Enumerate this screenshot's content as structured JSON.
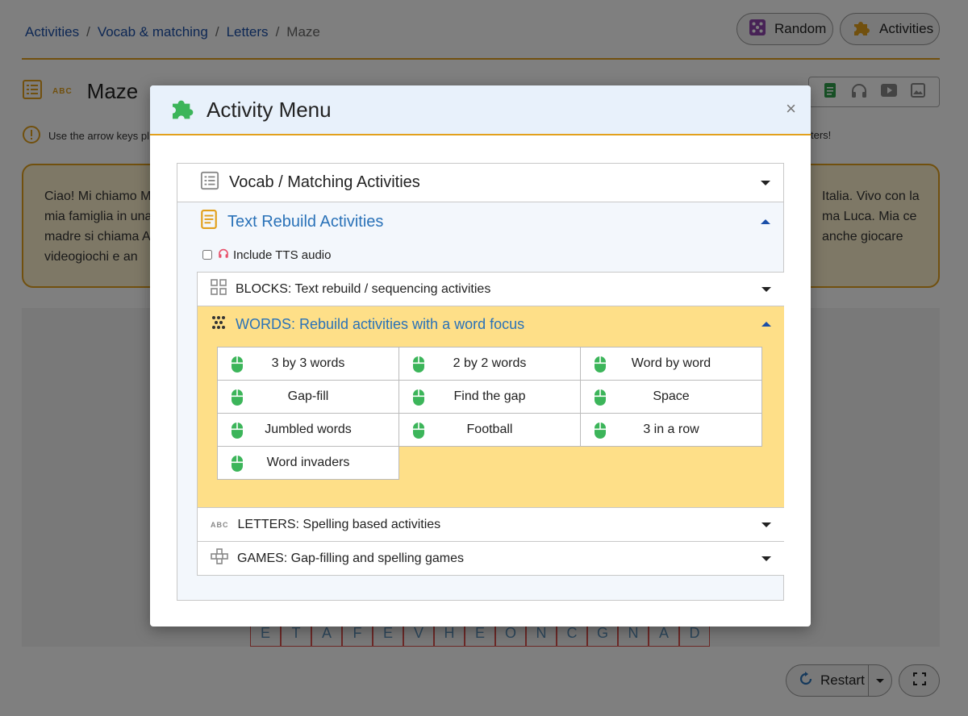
{
  "breadcrumb": {
    "items": [
      "Activities",
      "Vocab & matching",
      "Letters"
    ],
    "current": "Maze",
    "separator": "/"
  },
  "top_buttons": {
    "random": "Random",
    "activities": "Activities"
  },
  "page": {
    "title": "Maze",
    "abc_badge": "ABC",
    "info_text": "Use the arrow keys pl",
    "info_text_right": "ters!",
    "text_left": "Ciao! Mi chiamo M mia famiglia in una madre si chiama A ai videogiochi e an",
    "text_right": "Italia. Vivo con la ma Luca. Mia ce anche giocare",
    "maze_letters": [
      "E",
      "T",
      "A",
      "F",
      "E",
      "V",
      "H",
      "E",
      "O",
      "N",
      "C",
      "G",
      "N",
      "A",
      "D"
    ],
    "restart": "Restart"
  },
  "modal": {
    "title": "Activity Menu",
    "close": "×",
    "vocab_section": "Vocab / Matching Activities",
    "text_section": "Text Rebuild Activities",
    "tts_label": "Include TTS audio",
    "blocks": "BLOCKS: Text rebuild / sequencing activities",
    "words": "WORDS: Rebuild activities with a word focus",
    "word_activities": [
      "3 by 3 words",
      "2 by 2 words",
      "Word by word",
      "Gap-fill",
      "Find the gap",
      "Space",
      "Jumbled words",
      "Football",
      "3 in a row",
      "Word invaders"
    ],
    "letters": "LETTERS: Spelling based activities",
    "letters_badge": "ABC",
    "games": "GAMES: Gap-filling and spelling games"
  },
  "colors": {
    "accent_orange": "#e2a01c",
    "link_blue": "#1a4fa8",
    "open_blue": "#2a72b8",
    "words_bg": "#fedf88",
    "mouse_green": "#3cb55a"
  },
  "icons": {
    "random": "dice-icon",
    "activities": "puzzle-icon",
    "modal": "puzzle-icon",
    "vocab": "list-icon",
    "text": "document-icon",
    "blocks": "grid-icon",
    "words": "dots-icon",
    "cell": "mouse-icon",
    "letters": "abc-icon",
    "games": "gamepad-icon"
  }
}
